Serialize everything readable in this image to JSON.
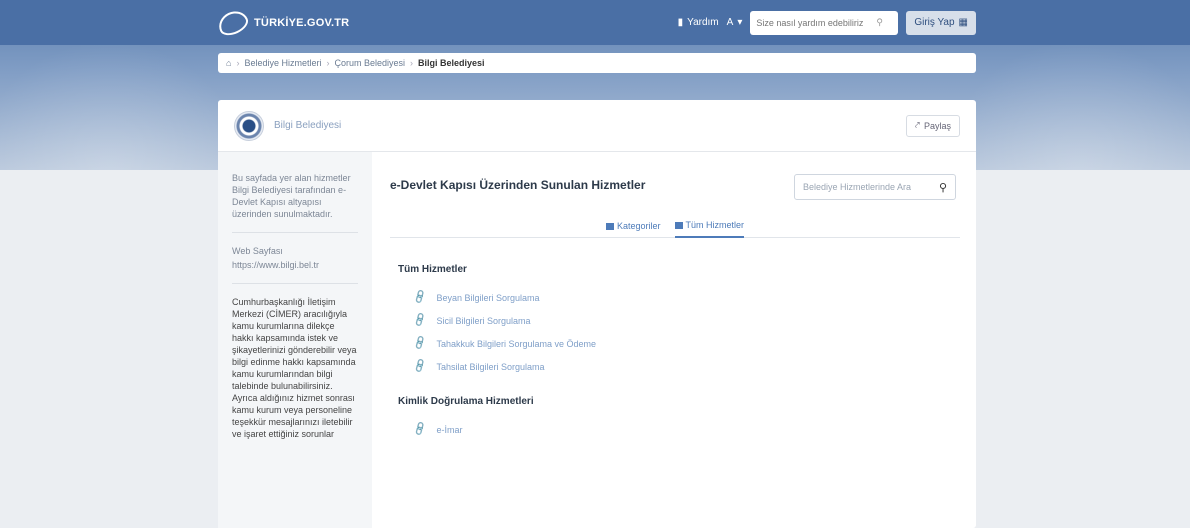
{
  "header": {
    "logo_text": "TÜRKİYE.GOV.TR",
    "help_link": "Yardım",
    "font_toggle": "A",
    "search_placeholder": "Size nasıl yardım edebiliriz",
    "login_label": "Giriş Yap"
  },
  "breadcrumb": {
    "items": [
      "Belediye Hizmetleri",
      "Çorum Belediyesi"
    ],
    "current": "Bilgi Belediyesi"
  },
  "institution": {
    "name": "Bilgi Belediyesi",
    "share_label": "Paylaş"
  },
  "sidebar": {
    "intro": "Bu sayfada yer alan hizmetler Bilgi Belediyesi tarafından e-Devlet Kapısı altyapısı üzerinden sunulmaktadır.",
    "web_label": "Web Sayfası",
    "web_url": "https://www.bilgi.bel.tr",
    "notice": "Cumhurbaşkanlığı İletişim Merkezi (CİMER) aracılığıyla kamu kurumlarına dilekçe hakkı kapsamında istek ve şikayetlerinizi gönderebilir veya bilgi edinme hakkı kapsamında kamu kurumlarından bilgi talebinde bulunabilirsiniz. Ayrıca aldığınız hizmet sonrası kamu kurum veya personeline teşekkür mesajlarınızı iletebilir ve işaret ettiğiniz sorunlar"
  },
  "main": {
    "title": "e-Devlet Kapısı Üzerinden Sunulan Hizmetler",
    "search_placeholder": "Belediye Hizmetlerinde Ara",
    "tabs": [
      {
        "label": "Kategoriler",
        "active": false
      },
      {
        "label": "Tüm Hizmetler",
        "active": true
      }
    ],
    "sections": [
      {
        "title": "Tüm Hizmetler",
        "items": [
          "Beyan Bilgileri Sorgulama",
          "Sicil Bilgileri Sorgulama",
          "Tahakkuk Bilgileri Sorgulama ve Ödeme",
          "Tahsilat Bilgileri Sorgulama"
        ]
      },
      {
        "title": "Kimlik Doğrulama Hizmetleri",
        "items": [
          "e-İmar"
        ]
      }
    ]
  },
  "colors": {
    "navbar": "#4a6fa5",
    "accent": "#4d7bb9",
    "link": "#7f9fc8"
  }
}
